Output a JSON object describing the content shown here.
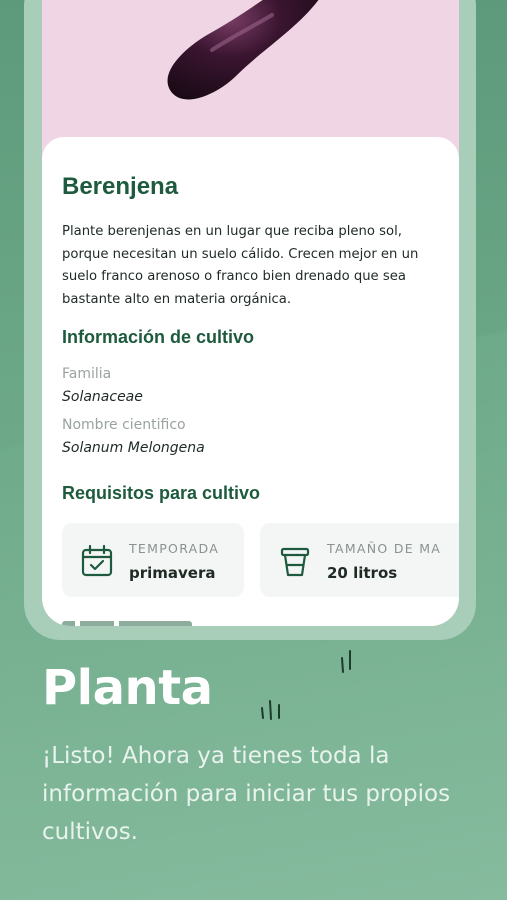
{
  "plant": {
    "name": "Berenjena",
    "description": "Plante berenjenas en un lugar que reciba pleno sol, porque necesitan un suelo cálido. Crecen mejor en un suelo franco arenoso o franco bien drenado que sea bastante alto en materia orgánica.",
    "image_icon": "eggplant-image"
  },
  "crop_info": {
    "heading": "Información de cultivo",
    "family_label": "Familia",
    "family_value": "Solanaceae",
    "scientific_label": "Nombre cientifico",
    "scientific_value": "Solanum Melongena"
  },
  "requirements": {
    "heading": "Requisitos para cultivo",
    "items": [
      {
        "label": "TEMPORADA",
        "value": "primavera",
        "icon": "calendar-icon"
      },
      {
        "label": "TAMAÑO DE MA",
        "value": "20 litros",
        "icon": "pot-icon"
      }
    ]
  },
  "promo": {
    "title": "Planta",
    "subtitle": "¡Listo! Ahora ya tienes toda la información para iniciar tus propios cultivos."
  },
  "colors": {
    "background_green": "#6aa786",
    "heading_green": "#1d5a3e",
    "screen_pink": "#f0d6e4",
    "phone_frame": "#a8cdb9"
  }
}
